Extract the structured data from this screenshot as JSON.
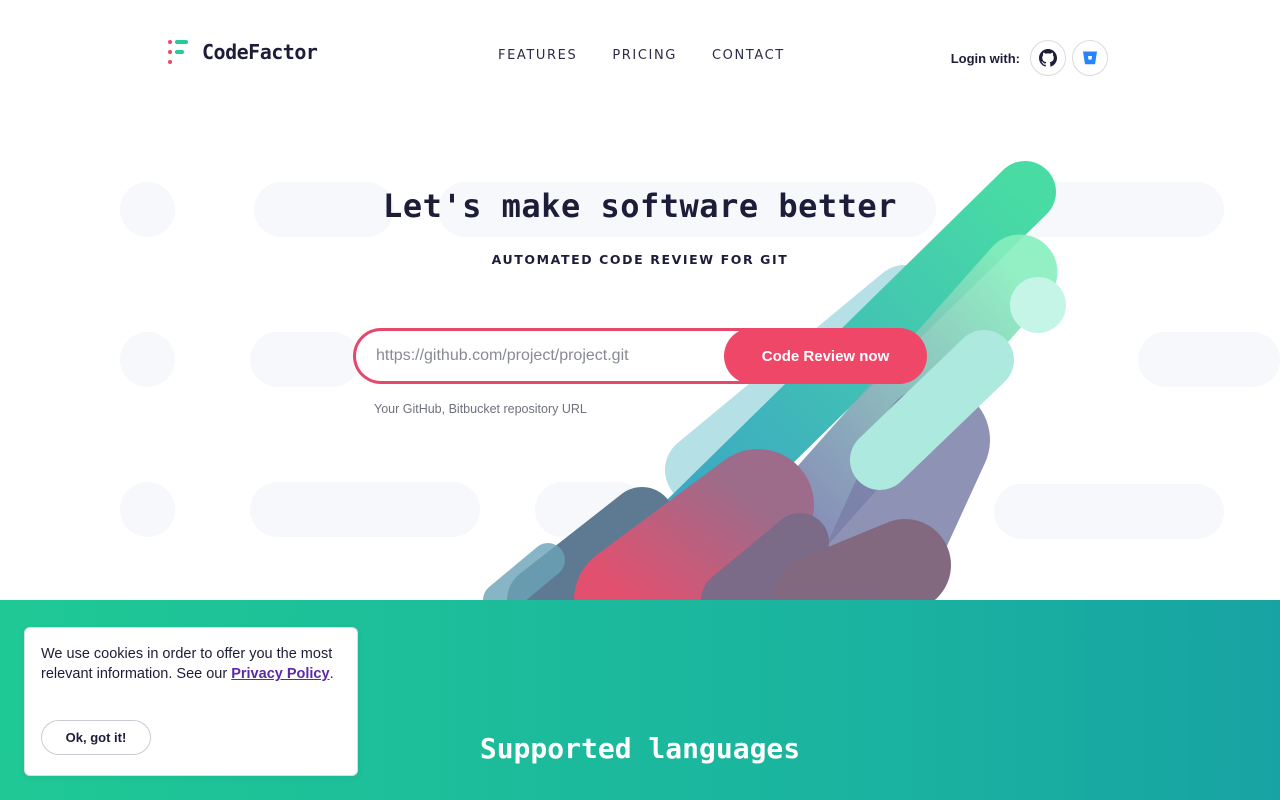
{
  "brand": {
    "name": "CodeFactor",
    "colors": {
      "accent": "#ef4768",
      "dark": "#1d1d3a",
      "teal": "#1fc995"
    }
  },
  "nav": {
    "items": [
      {
        "label": "FEATURES"
      },
      {
        "label": "PRICING"
      },
      {
        "label": "CONTACT"
      }
    ]
  },
  "login": {
    "label": "Login with:",
    "providers": [
      {
        "icon": "github-icon"
      },
      {
        "icon": "bitbucket-icon"
      }
    ]
  },
  "hero": {
    "title": "Let's make software better",
    "subtitle": "AUTOMATED CODE REVIEW FOR GIT",
    "input": {
      "placeholder": "https://github.com/project/project.git",
      "value": ""
    },
    "button_label": "Code Review now",
    "hint": "Your GitHub, Bitbucket repository URL"
  },
  "languages": {
    "title": "Supported languages"
  },
  "cookie": {
    "text_before": "We use cookies in order to offer you the most relevant information. See our ",
    "link_label": "Privacy Policy",
    "text_after": ".",
    "button_label": "Ok, got it!"
  }
}
